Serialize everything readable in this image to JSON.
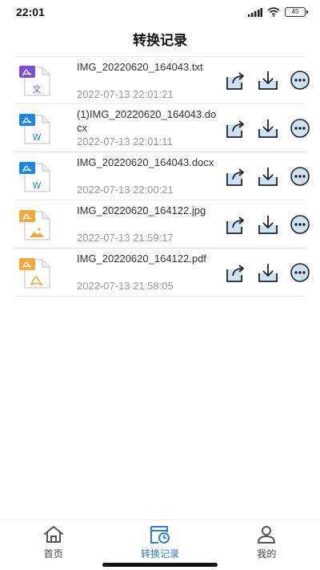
{
  "status_bar": {
    "time": "22:01",
    "battery": "45",
    "icons": [
      "signal-icon",
      "wifi-icon",
      "battery-icon"
    ]
  },
  "header": {
    "title": "转换记录"
  },
  "files": [
    {
      "name": "IMG_20220620_164043.txt",
      "date": "2022-07-13 22:01:21",
      "type": "txt",
      "badge": "文",
      "accent": "#7b4fd4"
    },
    {
      "name": "(1)IMG_20220620_164043.docx",
      "date": "2022-07-13 22:01:11",
      "type": "docx",
      "badge": "W",
      "accent": "#1f86e0"
    },
    {
      "name": "IMG_20220620_164043.docx",
      "date": "2022-07-13 22:00:21",
      "type": "docx",
      "badge": "W",
      "accent": "#1f86e0"
    },
    {
      "name": "IMG_20220620_164122.jpg",
      "date": "2022-07-13 21:59:17",
      "type": "jpg",
      "badge": "image",
      "accent": "#f2a83a"
    },
    {
      "name": "IMG_20220620_164122.pdf",
      "date": "2022-07-13 21:58:05",
      "type": "pdf",
      "badge": "pdf",
      "accent": "#f2a83a"
    }
  ],
  "row_actions": [
    "share-icon",
    "download-icon",
    "more-icon"
  ],
  "bottom_nav": {
    "items": [
      {
        "label": "首页",
        "icon": "home-icon",
        "active": false
      },
      {
        "label": "转换记录",
        "icon": "history-icon",
        "active": true
      },
      {
        "label": "我的",
        "icon": "profile-icon",
        "active": false
      }
    ]
  },
  "colors": {
    "accent_blue": "#2e7ed9",
    "action_fill": "#cfe3f7",
    "word_blue": "#1f86e0",
    "txt_purple": "#7b4fd4",
    "image_orange": "#f2a83a"
  }
}
